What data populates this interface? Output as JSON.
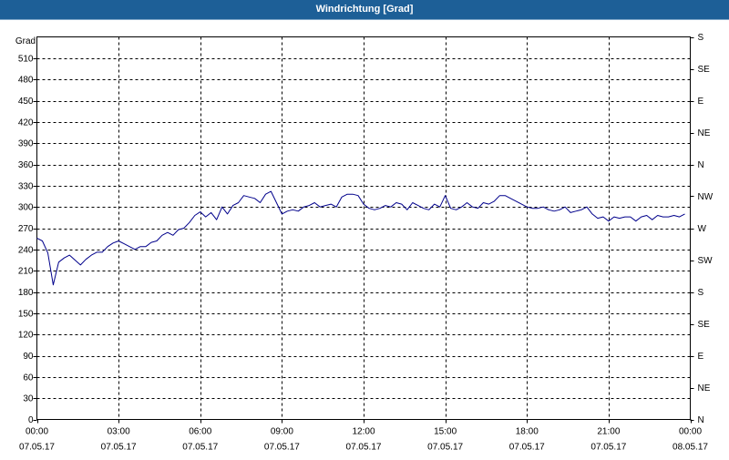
{
  "window": {
    "title": "Windrichtung [Grad]"
  },
  "chart_data": {
    "type": "line",
    "title": "Windrichtung [Grad]",
    "ylabel": "Grad",
    "ylim": [
      0,
      540
    ],
    "y_ticks": [
      0,
      30,
      60,
      90,
      120,
      150,
      180,
      210,
      240,
      270,
      300,
      330,
      360,
      390,
      420,
      450,
      480,
      510
    ],
    "x_ticks": [
      {
        "time": "00:00",
        "date": "07.05.17"
      },
      {
        "time": "03:00",
        "date": "07.05.17"
      },
      {
        "time": "06:00",
        "date": "07.05.17"
      },
      {
        "time": "09:00",
        "date": "07.05.17"
      },
      {
        "time": "12:00",
        "date": "07.05.17"
      },
      {
        "time": "15:00",
        "date": "07.05.17"
      },
      {
        "time": "18:00",
        "date": "07.05.17"
      },
      {
        "time": "21:00",
        "date": "07.05.17"
      },
      {
        "time": "00:00",
        "date": "08.05.17"
      }
    ],
    "right_axis": [
      {
        "label": "N",
        "value": 0
      },
      {
        "label": "NE",
        "value": 45
      },
      {
        "label": "E",
        "value": 90
      },
      {
        "label": "SE",
        "value": 135
      },
      {
        "label": "S",
        "value": 180
      },
      {
        "label": "SW",
        "value": 225
      },
      {
        "label": "W",
        "value": 270
      },
      {
        "label": "NW",
        "value": 315
      },
      {
        "label": "N",
        "value": 360
      },
      {
        "label": "NE",
        "value": 405
      },
      {
        "label": "E",
        "value": 450
      },
      {
        "label": "SE",
        "value": 495
      },
      {
        "label": "S",
        "value": 540
      }
    ],
    "grid": true,
    "series": [
      {
        "color": "#00008b",
        "x_hours": [
          0,
          0.2,
          0.4,
          0.6,
          0.8,
          1,
          1.2,
          1.4,
          1.6,
          1.8,
          2,
          2.2,
          2.4,
          2.6,
          2.8,
          3,
          3.2,
          3.4,
          3.6,
          3.8,
          4,
          4.2,
          4.4,
          4.6,
          4.8,
          5,
          5.2,
          5.4,
          5.6,
          5.8,
          6,
          6.2,
          6.4,
          6.6,
          6.8,
          7,
          7.2,
          7.4,
          7.6,
          7.8,
          8,
          8.2,
          8.4,
          8.6,
          8.8,
          9,
          9.2,
          9.4,
          9.6,
          9.8,
          10,
          10.2,
          10.4,
          10.6,
          10.8,
          11,
          11.2,
          11.4,
          11.6,
          11.8,
          12,
          12.2,
          12.4,
          12.6,
          12.8,
          13,
          13.2,
          13.4,
          13.6,
          13.8,
          14,
          14.2,
          14.4,
          14.6,
          14.8,
          15,
          15.2,
          15.4,
          15.6,
          15.8,
          16,
          16.2,
          16.4,
          16.6,
          16.8,
          17,
          17.2,
          17.4,
          17.6,
          17.8,
          18,
          18.2,
          18.4,
          18.6,
          18.8,
          19,
          19.2,
          19.4,
          19.6,
          19.8,
          20,
          20.2,
          20.4,
          20.6,
          20.8,
          21,
          21.2,
          21.4,
          21.6,
          21.8,
          22,
          22.2,
          22.4,
          22.6,
          22.8,
          23,
          23.2,
          23.4,
          23.6,
          23.8
        ],
        "values": [
          256,
          252,
          235,
          190,
          222,
          228,
          232,
          225,
          218,
          226,
          232,
          236,
          236,
          244,
          249,
          252,
          248,
          244,
          240,
          244,
          244,
          250,
          252,
          260,
          264,
          260,
          268,
          270,
          278,
          288,
          293,
          286,
          292,
          282,
          300,
          290,
          302,
          306,
          316,
          314,
          312,
          306,
          318,
          322,
          306,
          290,
          294,
          296,
          294,
          300,
          302,
          306,
          300,
          302,
          304,
          300,
          314,
          318,
          318,
          316,
          304,
          298,
          296,
          298,
          302,
          300,
          306,
          304,
          296,
          306,
          302,
          298,
          296,
          304,
          300,
          316,
          298,
          296,
          300,
          306,
          300,
          298,
          306,
          304,
          308,
          316,
          316,
          312,
          308,
          304,
          300,
          298,
          298,
          300,
          296,
          294,
          296,
          300,
          292,
          294,
          296,
          300,
          290,
          284,
          286,
          280,
          286,
          284,
          286,
          286,
          280,
          286,
          288,
          282,
          288,
          286,
          286,
          288,
          286,
          290
        ]
      }
    ]
  }
}
